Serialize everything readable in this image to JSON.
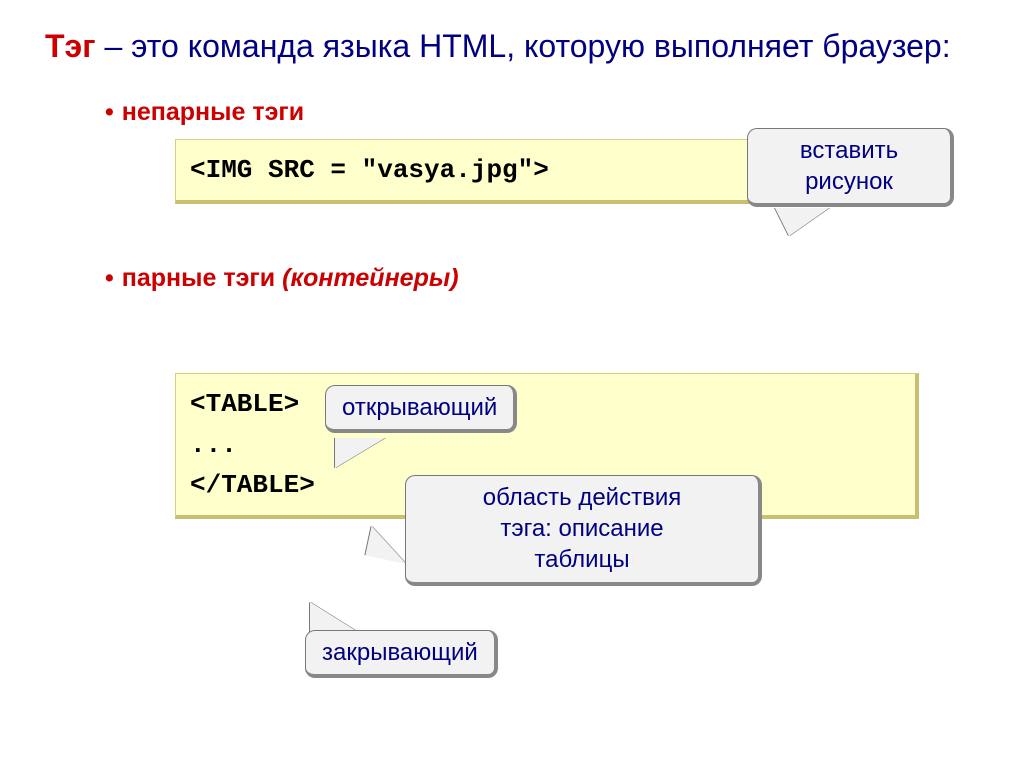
{
  "title": {
    "term": "Тэг",
    "rest": " – это команда языка HTML, которую выполняет браузер:"
  },
  "bullets": {
    "b1": {
      "dot": "•",
      "label": "непарные тэги"
    },
    "b2": {
      "dot": "•",
      "label": "парные тэги ",
      "paren": "(контейнеры)"
    }
  },
  "code": {
    "c1": "<IMG SRC = \"vasya.jpg\">",
    "c2": "<TABLE>\n...\n</TABLE>"
  },
  "callouts": {
    "insert_pic": "вставить\nрисунок",
    "opening": "открывающий",
    "scope": "область действия\nтэга: описание\nтаблицы",
    "closing": "закрывающий"
  }
}
